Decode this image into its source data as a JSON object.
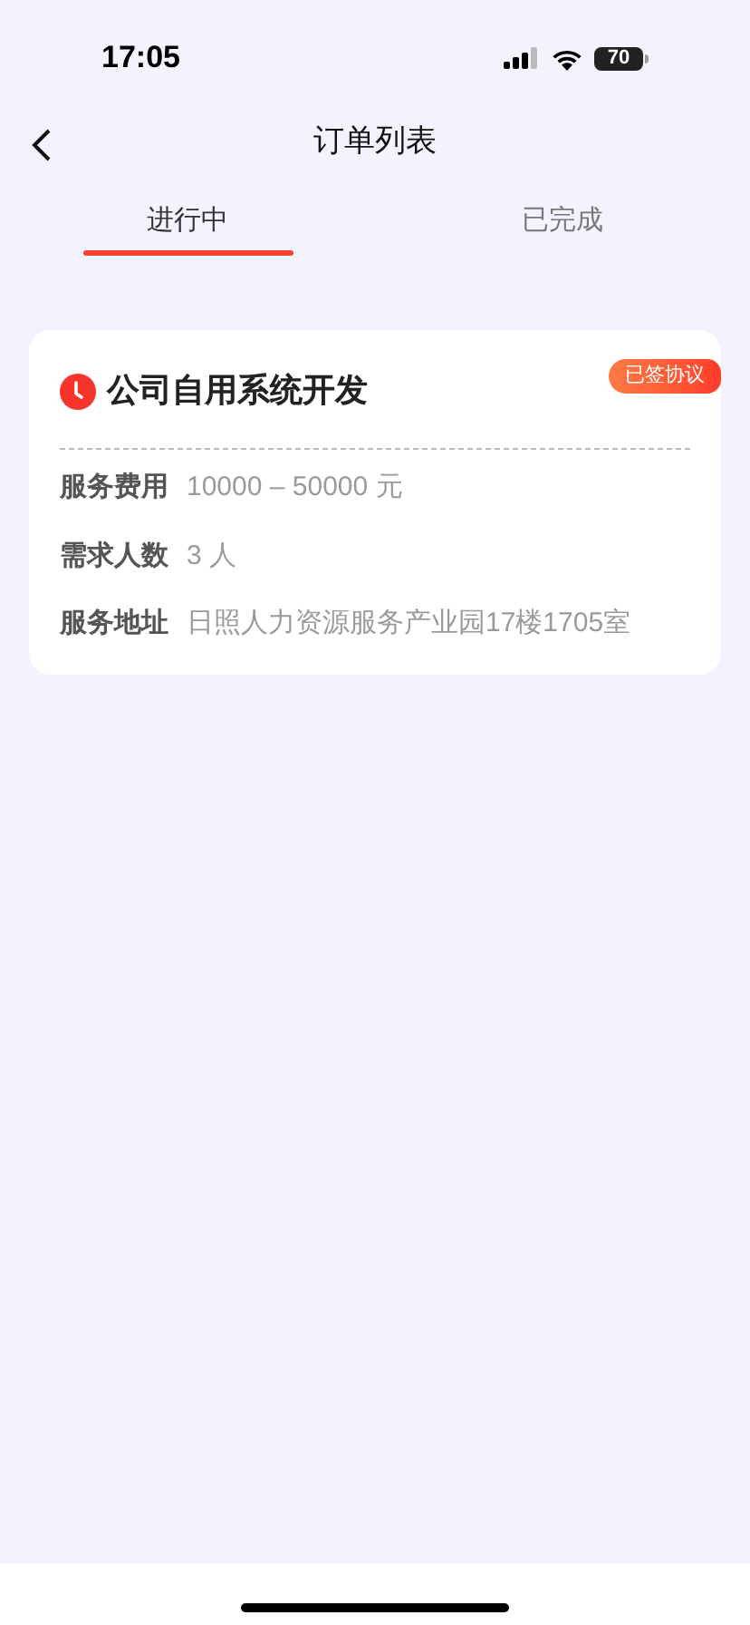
{
  "status_bar": {
    "time": "17:05",
    "battery": "70"
  },
  "header": {
    "title": "订单列表"
  },
  "tabs": [
    {
      "label": "进行中",
      "selected": true
    },
    {
      "label": "已完成",
      "selected": false
    }
  ],
  "orders": [
    {
      "title": "公司自用系统开发",
      "badge": "已签协议",
      "fields": [
        {
          "label": "服务费用",
          "value": "10000 – 50000 元"
        },
        {
          "label": "需求人数",
          "value": "3 人"
        },
        {
          "label": "服务地址",
          "value": "日照人力资源服务产业园17楼1705室"
        }
      ]
    }
  ]
}
